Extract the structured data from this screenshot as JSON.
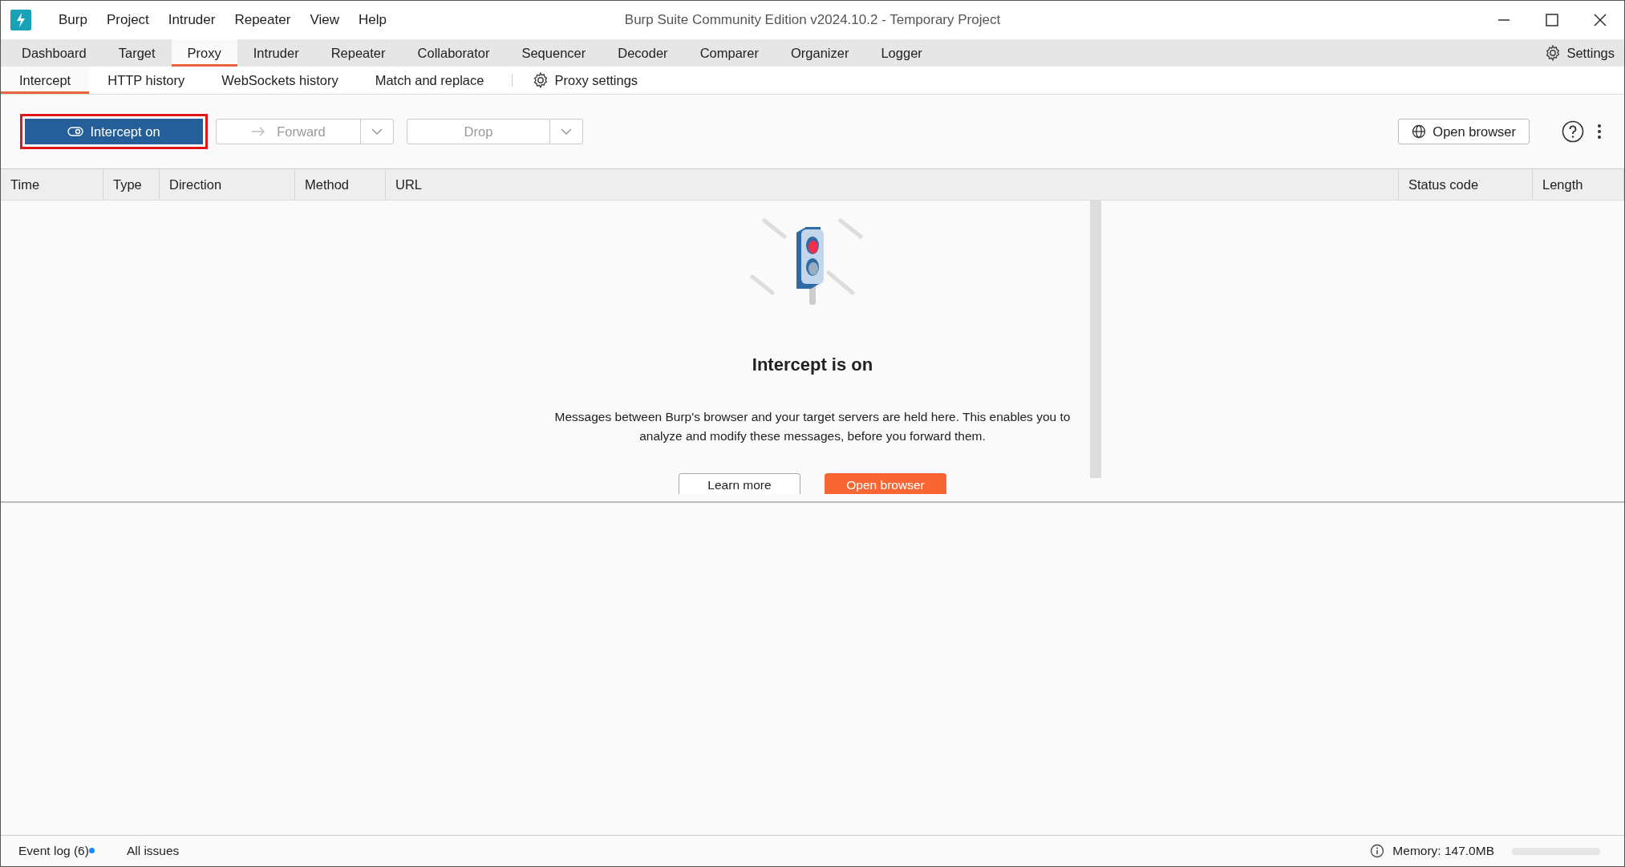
{
  "window": {
    "title": "Burp Suite Community Edition v2024.10.2 - Temporary Project"
  },
  "menu": [
    "Burp",
    "Project",
    "Intruder",
    "Repeater",
    "View",
    "Help"
  ],
  "tabs": [
    {
      "label": "Dashboard",
      "selected": false
    },
    {
      "label": "Target",
      "selected": false
    },
    {
      "label": "Proxy",
      "selected": true
    },
    {
      "label": "Intruder",
      "selected": false
    },
    {
      "label": "Repeater",
      "selected": false
    },
    {
      "label": "Collaborator",
      "selected": false
    },
    {
      "label": "Sequencer",
      "selected": false
    },
    {
      "label": "Decoder",
      "selected": false
    },
    {
      "label": "Comparer",
      "selected": false
    },
    {
      "label": "Organizer",
      "selected": false
    },
    {
      "label": "Logger",
      "selected": false
    }
  ],
  "settings_button": "Settings",
  "subtabs": [
    {
      "label": "Intercept",
      "selected": true
    },
    {
      "label": "HTTP history",
      "selected": false
    },
    {
      "label": "WebSockets history",
      "selected": false
    },
    {
      "label": "Match and replace",
      "selected": false
    }
  ],
  "proxy_settings": "Proxy settings",
  "toolbar": {
    "intercept": {
      "label": "Intercept on",
      "on": true
    },
    "forward": {
      "label": "Forward",
      "disabled": true
    },
    "drop": {
      "label": "Drop",
      "disabled": true
    },
    "open_browser": "Open browser"
  },
  "table": {
    "columns": [
      "Time",
      "Type",
      "Direction",
      "Method",
      "URL",
      "Status code",
      "Length"
    ]
  },
  "empty_state": {
    "title": "Intercept is on",
    "message": "Messages between Burp's browser and your target servers are held here. This enables you to analyze and modify these messages, before you forward them.",
    "buttons": [
      {
        "label": "Learn more",
        "kind": "secondary"
      },
      {
        "label": "Open browser",
        "kind": "primary"
      }
    ]
  },
  "status_bar": {
    "event_log": "Event log (6)",
    "unread": true,
    "all_issues": "All issues",
    "memory": "Memory: 147.0MB"
  }
}
